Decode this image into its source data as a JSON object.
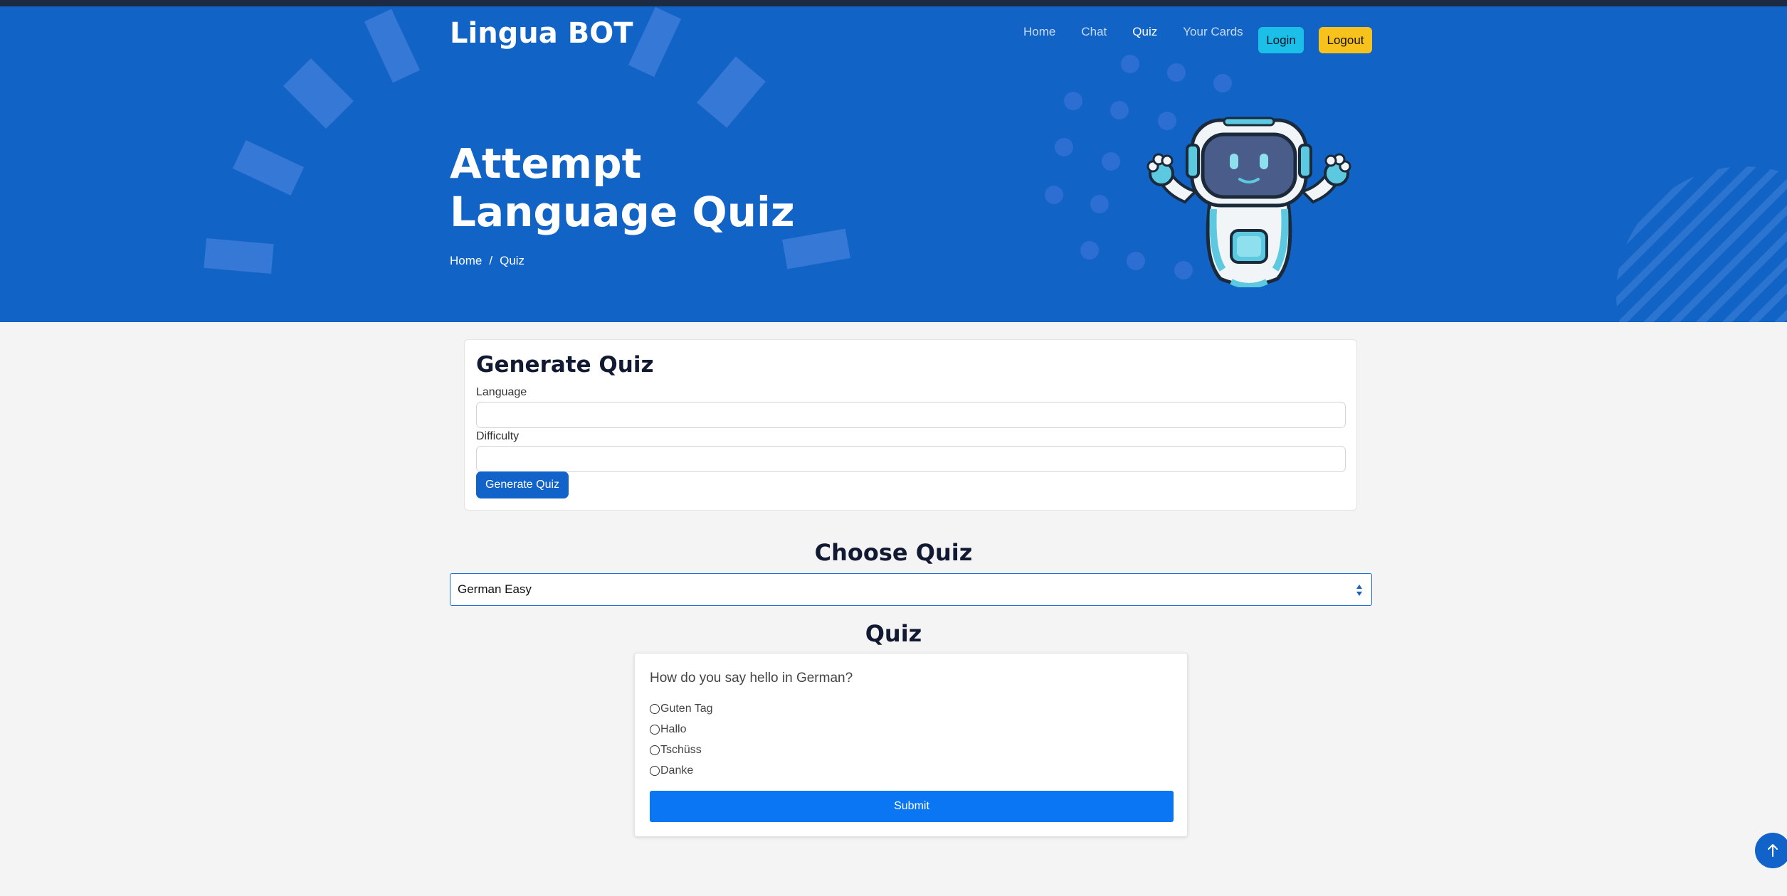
{
  "brand": "Lingua BOT",
  "nav": {
    "home": "Home",
    "chat": "Chat",
    "quiz": "Quiz",
    "cards": "Your Cards",
    "login": "Login",
    "logout": "Logout"
  },
  "hero": {
    "title": "Attempt Language Quiz",
    "breadcrumb": {
      "home": "Home",
      "separator": "/",
      "current": "Quiz"
    }
  },
  "generate": {
    "title": "Generate Quiz",
    "language_label": "Language",
    "language_value": "",
    "difficulty_label": "Difficulty",
    "difficulty_value": "",
    "button": "Generate Quiz"
  },
  "choose": {
    "title": "Choose Quiz",
    "selected": "German Easy"
  },
  "quiz": {
    "title": "Quiz",
    "question": "How do you say hello in German?",
    "options": [
      "Guten Tag",
      "Hallo",
      "Tschüss",
      "Danke"
    ],
    "submit": "Submit"
  },
  "icons": {
    "scroll_top": "arrow-up-icon",
    "select_arrows": "sort-arrows-icon",
    "robot": "robot-mascot"
  },
  "colors": {
    "hero_bg": "#1163c6",
    "login_btn": "#1bbfe8",
    "logout_btn": "#f8c21c",
    "primary_btn": "#1162c9",
    "submit_btn": "#0a76f4"
  }
}
